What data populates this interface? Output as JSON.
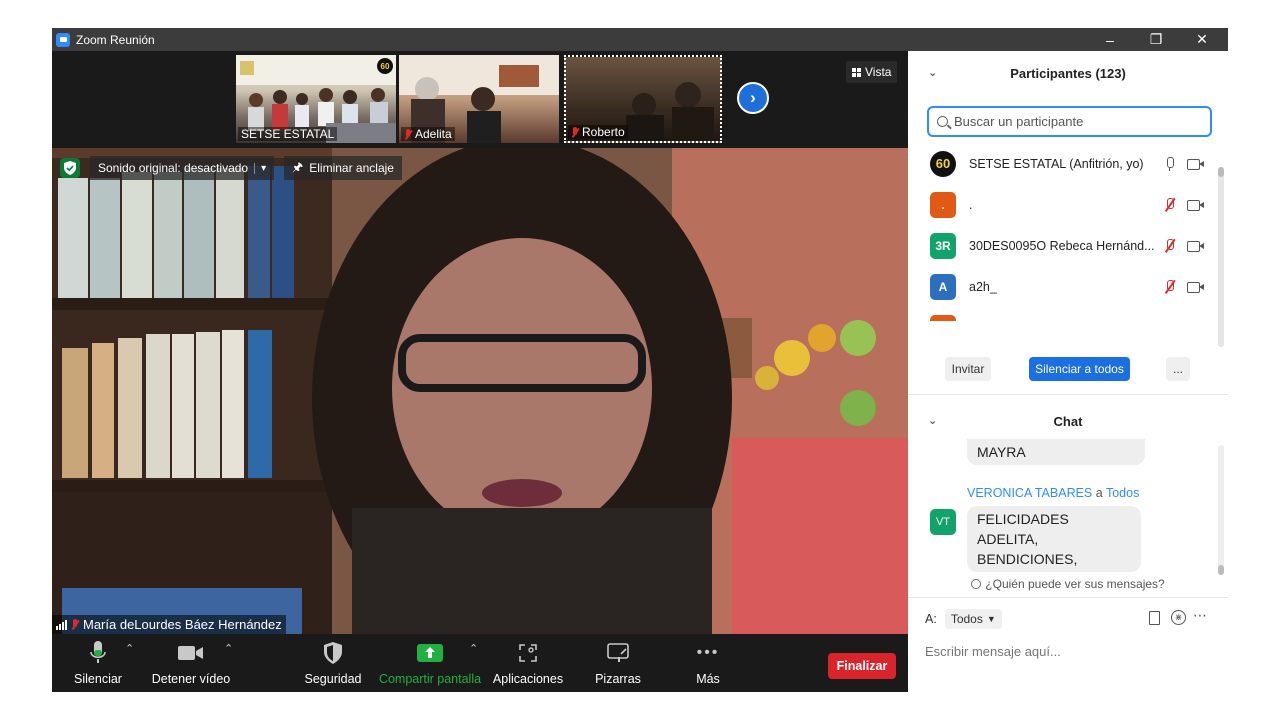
{
  "window": {
    "title": "Zoom Reunión",
    "minimize": "–",
    "restore": "❐",
    "close": "✕"
  },
  "thumbnails": [
    {
      "name": "SETSE ESTATAL",
      "muted": false,
      "badge": "60"
    },
    {
      "name": "Adelita",
      "muted": true
    },
    {
      "name": "Roberto",
      "muted": true
    }
  ],
  "view_button": {
    "label": "Vista"
  },
  "main_video": {
    "speaker": "María deLourdes Báez Hernández",
    "original_sound": "Sonido original: desactivado",
    "unpin": "Eliminar anclaje"
  },
  "toolbar": {
    "mute": "Silenciar",
    "stop_video": "Detener vídeo",
    "security": "Seguridad",
    "share": "Compartir pantalla",
    "apps": "Aplicaciones",
    "whiteboards": "Pizarras",
    "more": "Más",
    "end": "Finalizar"
  },
  "participants_panel": {
    "title": "Participantes (123)",
    "search_placeholder": "Buscar un participante",
    "rows": [
      {
        "avatar": "60",
        "avatar_color": "#111111",
        "name": "SETSE ESTATAL (Anfitrión, yo)",
        "mic": "on"
      },
      {
        "avatar": ".",
        "avatar_color": "#e05a13",
        "name": ".",
        "mic": "off"
      },
      {
        "avatar": "3R",
        "avatar_color": "#11a36a",
        "name": "30DES0095O  Rebeca Hernánd...",
        "mic": "off"
      },
      {
        "avatar": "A",
        "avatar_color": "#2b6fbd",
        "name": "a2h_",
        "mic": "off"
      },
      {
        "avatar": "",
        "avatar_color": "#e05a13",
        "name": "",
        "mic": "off"
      }
    ],
    "invite": "Invitar",
    "mute_all": "Silenciar a todos",
    "more": "..."
  },
  "chat_panel": {
    "title": "Chat",
    "prev_message": "MAYRA",
    "sender": "VERONICA TABARES",
    "to_word": "a",
    "recipient": "Todos",
    "sender_initials": "VT",
    "message_line1": "FELICIDADES ADELITA,",
    "message_line2": "BENDICIONES,",
    "who_can_see": "¿Quién puede ver sus mensajes?",
    "to_label": "A:",
    "to_value": "Todos",
    "input_placeholder": "Escribir mensaje aquí..."
  },
  "colors": {
    "accent_blue": "#2d8cff",
    "end_red": "#d8242a",
    "share_green": "#1fb141",
    "shield_green": "#0a7a34"
  }
}
